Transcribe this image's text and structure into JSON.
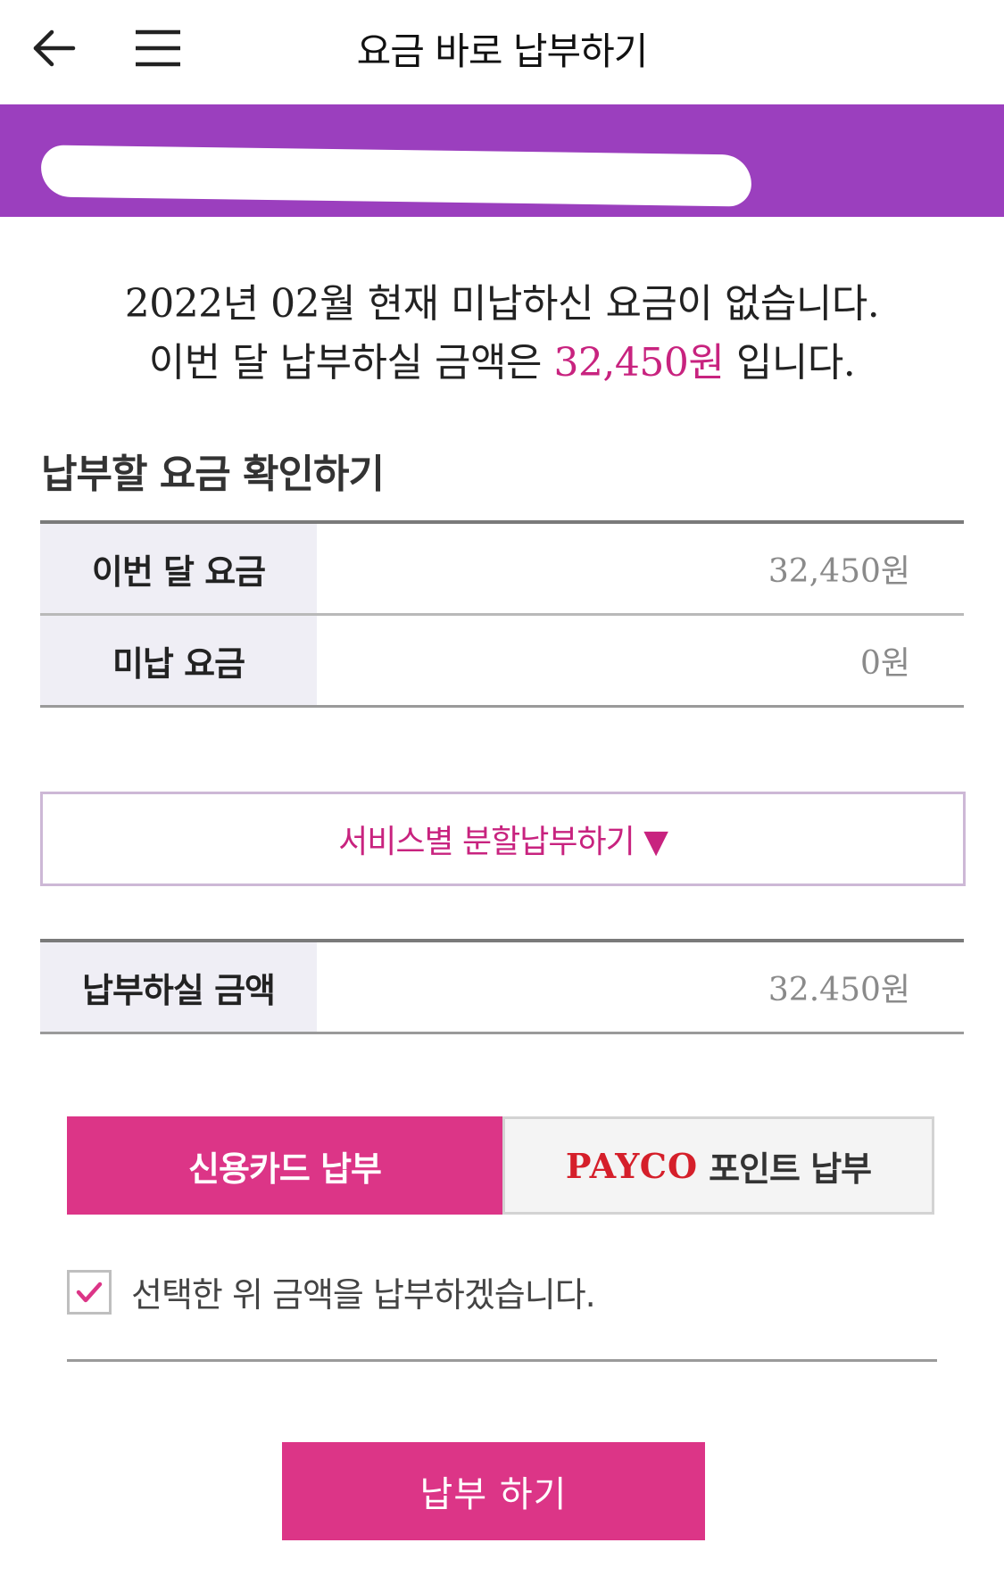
{
  "header": {
    "title": "요금 바로 납부하기",
    "back_icon": "arrow-left-icon",
    "menu_icon": "hamburger-menu-icon"
  },
  "banner": {
    "color": "#9b3fbe"
  },
  "notice": {
    "line1": "2022년 02월 현재 미납하신 요금이 없습니다.",
    "line2_prefix": "이번 달 납부하실 금액은 ",
    "line2_amount": "32,450원",
    "line2_suffix": " 입니다."
  },
  "bill_section": {
    "title": "납부할 요금 확인하기",
    "rows": [
      {
        "label": "이번 달 요금",
        "value": "32,450원"
      },
      {
        "label": "미납 요금",
        "value": "0원"
      }
    ]
  },
  "split_button": {
    "label": "서비스별 분할납부하기 ▼"
  },
  "payment_total": {
    "label": "납부하실 금액",
    "value": "32.450원"
  },
  "payment_tabs": {
    "credit_card": "신용카드 납부",
    "payco_brand": "PAYCO",
    "payco_rest": "포인트 납부"
  },
  "agreement": {
    "checked": true,
    "label": "선택한 위 금액을 납부하겠습니다."
  },
  "pay_button": {
    "label": "납부 하기"
  },
  "colors": {
    "accent": "#dc3587",
    "banner": "#9b3fbe",
    "amount_text": "#c8237f",
    "payco_red": "#d51f2a"
  }
}
